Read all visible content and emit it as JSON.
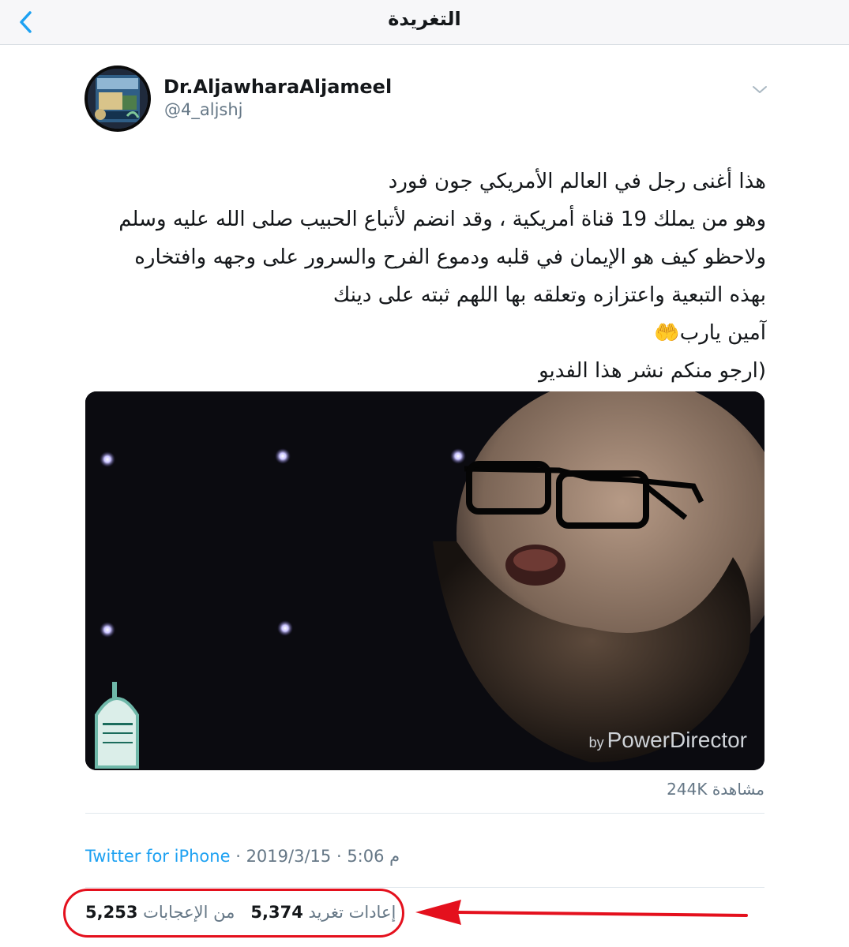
{
  "header": {
    "title": "التغريدة",
    "back_icon": "chevron-left-icon"
  },
  "author": {
    "display_name": "Dr.AljawharaAljameel",
    "handle": "@4_aljshj",
    "avatar_icon": "profile-photo",
    "menu_icon": "chevron-down-icon"
  },
  "tweet": {
    "lines": [
      "هذا أغنى رجل في العالم الأمريكي جون فورد",
      "وهو من يملك 19 قناة أمريكية ، وقد انضم لأتباع الحبيب صلى الله عليه وسلم",
      "ولاحظو كيف هو الإيمان في قلبه ودموع الفرح والسرور على وجهه وافتخاره",
      "بهذه التبعية واعتزازه وتعلقه بها اللهم ثبته على دينك",
      "آمين يارب🤲",
      "(ارجو منكم نشر هذا الفديو"
    ]
  },
  "media": {
    "watermark_by": "by",
    "watermark_brand": "PowerDirector",
    "views": "244K مشاهدة"
  },
  "meta": {
    "time": "5:06 م",
    "date": "2019/3/15",
    "source": "Twitter for iPhone",
    "separator": "·"
  },
  "stats": {
    "likes_count": "5,253",
    "likes_label": "من الإعجابات",
    "retweets_count": "5,374",
    "retweets_label": "إعادات تغريد"
  },
  "annotation": {
    "color": "#e4101d",
    "shape": "red-ellipse-with-arrow"
  }
}
